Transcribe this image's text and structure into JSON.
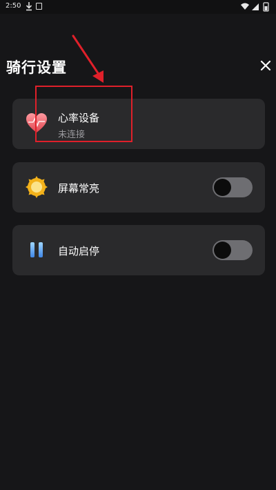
{
  "status_bar": {
    "time": "2:50"
  },
  "header": {
    "title": "骑行设置",
    "close_icon": "close-icon"
  },
  "settings": {
    "heart_rate": {
      "label": "心率设备",
      "status": "未连接",
      "icon": "heart-icon"
    },
    "screen_on": {
      "label": "屏幕常亮",
      "icon": "sun-icon",
      "enabled": false
    },
    "auto_pause": {
      "label": "自动启停",
      "icon": "pause-icon",
      "enabled": false
    }
  },
  "colors": {
    "background": "#161618",
    "card": "#2a2a2c",
    "toggle_track": "#6e6e72",
    "annotation": "#e0202a",
    "subtext": "#9a9a9e"
  }
}
